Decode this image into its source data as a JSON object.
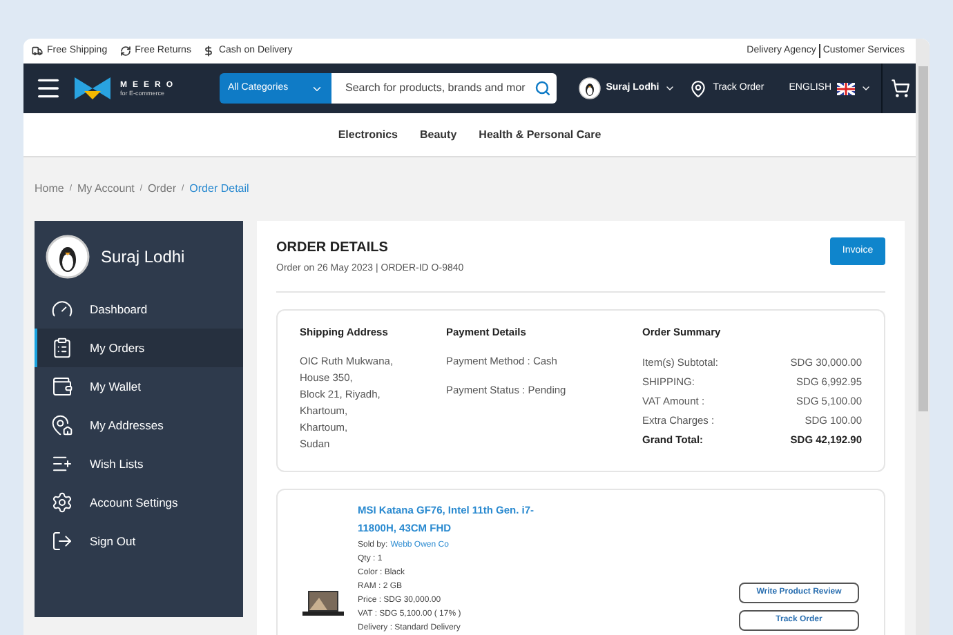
{
  "top_strip": {
    "perks": [
      {
        "kind": "truck",
        "label": "Free Shipping"
      },
      {
        "kind": "returns",
        "label": "Free Returns"
      },
      {
        "kind": "cash",
        "label": "Cash on Delivery"
      }
    ],
    "links": [
      "Delivery Agency",
      "Customer Services"
    ]
  },
  "header": {
    "brand": "MEERO",
    "tagline": "for E-commerce",
    "category": "All Categories",
    "search": {
      "placeholder": "Search for products, brands and mor"
    },
    "user": "Suraj Lodhi",
    "track": "Track Order",
    "language": "ENGLISH"
  },
  "categories": [
    "Electronics",
    "Beauty",
    "Health & Personal Care"
  ],
  "breadcrumb_separator": "/",
  "breadcrumb": [
    {
      "label": "Home",
      "selected": false
    },
    {
      "label": "My Account",
      "selected": false
    },
    {
      "label": "Order",
      "selected": false
    },
    {
      "label": "Order Detail",
      "selected": true
    }
  ],
  "sidebar": {
    "user": "Suraj Lodhi",
    "items": [
      {
        "kind": "dashboard",
        "label": "Dashboard",
        "selected": false
      },
      {
        "kind": "orders",
        "label": "My Orders",
        "selected": true
      },
      {
        "kind": "wallet",
        "label": "My Wallet",
        "selected": false
      },
      {
        "kind": "addresses",
        "label": "My Addresses",
        "selected": false
      },
      {
        "kind": "wishlist",
        "label": "Wish Lists",
        "selected": false
      },
      {
        "kind": "settings",
        "label": "Account Settings",
        "selected": false
      },
      {
        "kind": "signout",
        "label": "Sign Out",
        "selected": false
      }
    ]
  },
  "order": {
    "title": "ORDER DETAILS",
    "subtitle": "Order on 26 May 2023 | ORDER-ID O-9840",
    "invoice": "Invoice",
    "shipping": {
      "title": "Shipping Address",
      "lines": [
        "OIC Ruth Mukwana,",
        "House 350,",
        "Block 21, Riyadh,",
        "Khartoum,",
        "Khartoum,",
        "Sudan"
      ]
    },
    "payment": {
      "title": "Payment Details",
      "lines": [
        "Payment Method : Cash",
        "Payment Status : Pending"
      ]
    },
    "summary": {
      "title": "Order Summary",
      "rows": [
        {
          "label": "Item(s) Subtotal:",
          "value": "SDG 30,000.00",
          "total": false
        },
        {
          "label": "SHIPPING:",
          "value": "SDG 6,992.95",
          "total": false
        },
        {
          "label": "VAT Amount :",
          "value": "SDG 5,100.00",
          "total": false
        },
        {
          "label": "Extra Charges :",
          "value": "SDG 100.00",
          "total": false
        },
        {
          "label": "Grand Total:",
          "value": "SDG 42,192.90",
          "total": true
        }
      ]
    },
    "item": {
      "name": "MSI Katana GF76, Intel 11th Gen. i7-11800H, 43CM FHD",
      "sold_by_label": "Sold by:",
      "seller": "Webb Owen Co",
      "details": [
        "Qty : 1",
        "Color : Black",
        "RAM : 2 GB",
        "Price : SDG 30,000.00",
        "VAT : SDG 5,100.00 ( 17% )",
        "Delivery : Standard Delivery"
      ],
      "actions": [
        "Write Product Review",
        "Track Order"
      ]
    }
  }
}
